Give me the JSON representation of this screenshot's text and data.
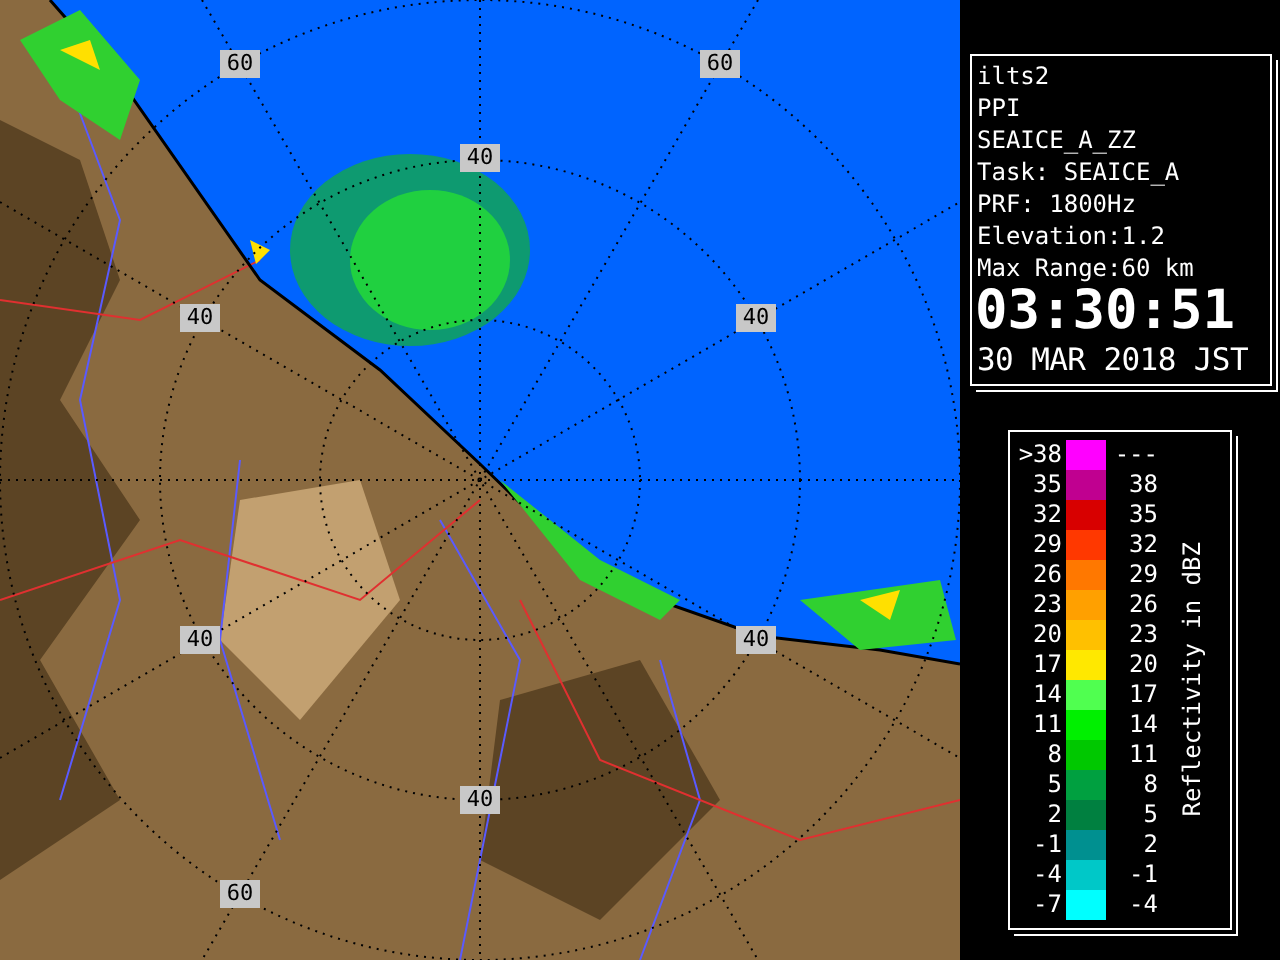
{
  "map": {
    "range_labels": [
      "60",
      "60",
      "40",
      "40",
      "40",
      "40",
      "40",
      "40",
      "60"
    ]
  },
  "info": {
    "lines": [
      "ilts2",
      "PPI",
      "SEAICE_A_ZZ",
      "Task: SEAICE_A",
      "PRF: 1800Hz",
      "Elevation:1.2",
      "Max Range:60 km"
    ],
    "time": "03:30:51",
    "date": "30 MAR 2018 JST"
  },
  "legend": {
    "title": "Reflectivity in dBZ",
    "rows": [
      {
        "low": ">38",
        "high": "---",
        "color": "#ff00ff"
      },
      {
        "low": "35",
        "high": "38",
        "color": "#c00090"
      },
      {
        "low": "32",
        "high": "35",
        "color": "#d80000"
      },
      {
        "low": "29",
        "high": "32",
        "color": "#ff3800"
      },
      {
        "low": "26",
        "high": "29",
        "color": "#ff7800"
      },
      {
        "low": "23",
        "high": "26",
        "color": "#ffa000"
      },
      {
        "low": "20",
        "high": "23",
        "color": "#ffc000"
      },
      {
        "low": "17",
        "high": "20",
        "color": "#ffe800"
      },
      {
        "low": "14",
        "high": "17",
        "color": "#50ff50"
      },
      {
        "low": "11",
        "high": "14",
        "color": "#00f000"
      },
      {
        "low": "8",
        "high": "11",
        "color": "#00c800"
      },
      {
        "low": "5",
        "high": "8",
        "color": "#00a040"
      },
      {
        "low": "2",
        "high": "5",
        "color": "#008040"
      },
      {
        "low": "-1",
        "high": "2",
        "color": "#009090"
      },
      {
        "low": "-4",
        "high": "-1",
        "color": "#00c8c8"
      },
      {
        "low": "-7",
        "high": "-4",
        "color": "#00ffff"
      }
    ]
  }
}
